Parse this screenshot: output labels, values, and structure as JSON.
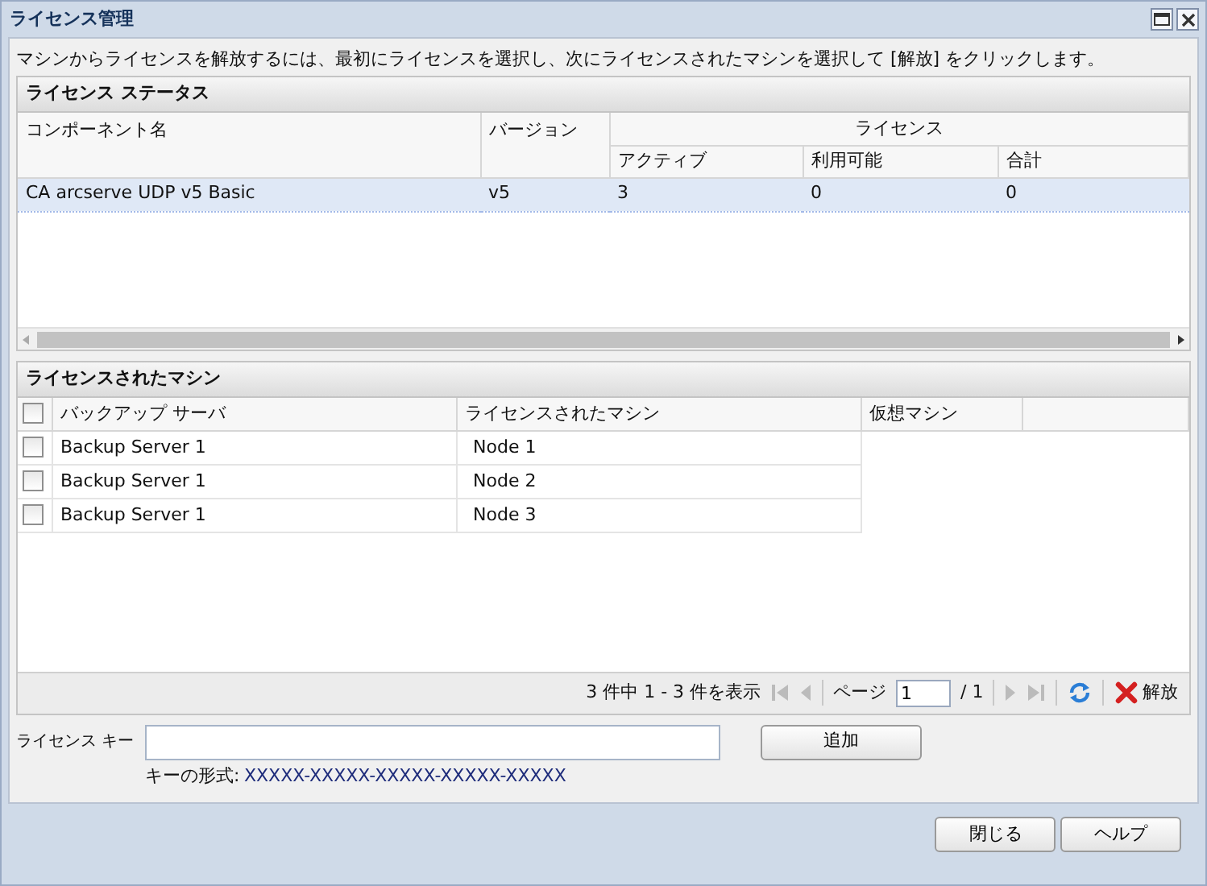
{
  "window": {
    "title": "ライセンス管理"
  },
  "instruction": "マシンからライセンスを解放するには、最初にライセンスを選択し、次にライセンスされたマシンを選択して [解放] をクリックします。",
  "license_status": {
    "title": "ライセンス ステータス",
    "columns": [
      "コンポーネント名",
      "バージョン"
    ],
    "group_header": "ライセンス",
    "sub_columns": [
      "アクティブ",
      "利用可能",
      "合計"
    ],
    "rows": [
      {
        "cells": [
          "CA arcserve UDP v5 Basic",
          "v5",
          "3",
          "0",
          "0"
        ],
        "selected": true
      }
    ]
  },
  "licensed_machines": {
    "title": "ライセンスされたマシン",
    "header_checked": false,
    "columns": [
      "バックアップ サーバ",
      "ライセンスされたマシン",
      "仮想マシン"
    ],
    "rows": [
      {
        "checked": false,
        "cells": [
          "Backup Server 1",
          "Node 1"
        ]
      },
      {
        "checked": false,
        "cells": [
          "Backup Server 1",
          "Node 2"
        ]
      },
      {
        "checked": false,
        "cells": [
          "Backup Server 1",
          "Node 3"
        ]
      }
    ],
    "pager": {
      "summary": "3 件中 1 - 3 件を表示",
      "page_label": "ページ",
      "page": "1",
      "page_total": "/ 1",
      "release": "解放"
    }
  },
  "license_key": {
    "label": "ライセンス キー",
    "hint_label": "キーの形式:",
    "hint_format": "XXXXX-XXXXX-XXXXX-XXXXX-XXXXX",
    "add": "追加"
  },
  "buttons": [
    "閉じる",
    "ヘルプ"
  ]
}
